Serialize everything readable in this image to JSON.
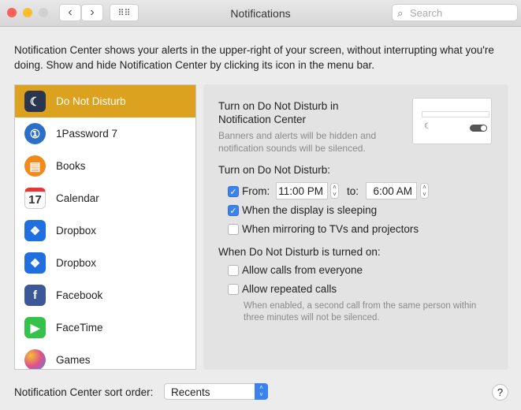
{
  "window": {
    "title": "Notifications",
    "search_placeholder": "Search"
  },
  "description": "Notification Center shows your alerts in the upper-right of your screen, without interrupting what you're doing. Show and hide Notification Center by clicking its icon in the menu bar.",
  "apps": [
    {
      "label": "Do Not Disturb",
      "icon": "moon-icon",
      "color": "#2a3550",
      "selected": true
    },
    {
      "label": "1Password 7",
      "icon": "1password-icon",
      "color": "#2b6fc9"
    },
    {
      "label": "Books",
      "icon": "books-icon",
      "color": "#f08a1c"
    },
    {
      "label": "Calendar",
      "icon": "calendar-icon",
      "color": "#ffffff",
      "glyph": "17"
    },
    {
      "label": "Dropbox",
      "icon": "dropbox-icon",
      "color": "#1f6fe0"
    },
    {
      "label": "Dropbox",
      "icon": "dropbox-icon",
      "color": "#1f6fe0"
    },
    {
      "label": "Facebook",
      "icon": "facebook-icon",
      "color": "#3b5998",
      "glyph": "f"
    },
    {
      "label": "FaceTime",
      "icon": "facetime-icon",
      "color": "#35c24a"
    },
    {
      "label": "Games",
      "icon": "games-icon",
      "color": "#e0508a"
    }
  ],
  "dnd": {
    "heading": "Turn on Do Not Disturb in Notification Center",
    "sub": "Banners and alerts will be hidden and notification sounds will be silenced.",
    "schedule_heading": "Turn on Do Not Disturb:",
    "from_label": "From:",
    "from_value": "11:00 PM",
    "to_label": "to:",
    "to_value": "6:00 AM",
    "sleeping_label": "When the display is sleeping",
    "mirroring_label": "When mirroring to TVs and projectors",
    "when_on_heading": "When Do Not Disturb is turned on:",
    "calls_label": "Allow calls from everyone",
    "repeated_label": "Allow repeated calls",
    "repeated_note": "When enabled, a second call from the same person within three minutes will not be silenced."
  },
  "footer": {
    "sort_label": "Notification Center sort order:",
    "sort_value": "Recents",
    "help": "?"
  }
}
